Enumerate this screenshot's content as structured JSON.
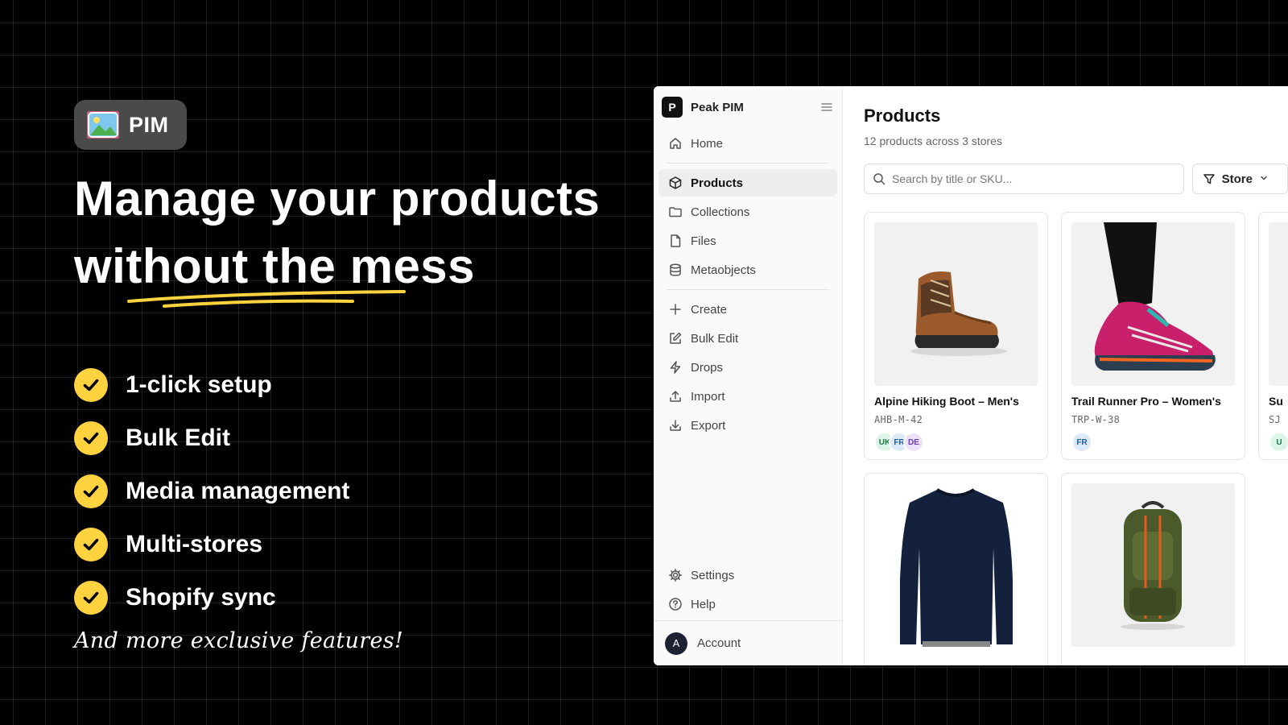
{
  "hero": {
    "badge_label": "PIM",
    "headline_line1": "Manage your products",
    "headline_line2": "without the mess",
    "features": [
      "1-click setup",
      "Bulk Edit",
      "Media management",
      "Multi-stores",
      "Shopify sync"
    ],
    "more": "And more exclusive features!",
    "accent_color": "#ffd23f"
  },
  "app": {
    "brand": {
      "logo_letter": "P",
      "name": "Peak PIM"
    },
    "nav": {
      "home": "Home",
      "products": "Products",
      "collections": "Collections",
      "files": "Files",
      "metaobjects": "Metaobjects",
      "create": "Create",
      "bulk_edit": "Bulk Edit",
      "drops": "Drops",
      "import": "Import",
      "export": "Export",
      "settings": "Settings",
      "help": "Help"
    },
    "account": {
      "initial": "A",
      "label": "Account"
    },
    "main": {
      "title": "Products",
      "subtitle": "12 products across 3 stores",
      "search_placeholder": "Search by title or SKU...",
      "store_filter_label": "Store"
    },
    "products": [
      {
        "name": "Alpine Hiking Boot – Men's",
        "sku": "AHB-M-42",
        "stores": [
          "UK",
          "FR",
          "DE"
        ]
      },
      {
        "name": "Trail Runner Pro – Women's",
        "sku": "TRP-W-38",
        "stores": [
          "FR"
        ]
      },
      {
        "name": "Su",
        "sku": "SJ",
        "stores": [
          "U"
        ]
      },
      {
        "name": "",
        "sku": "",
        "stores": []
      },
      {
        "name": "",
        "sku": "",
        "stores": []
      }
    ]
  }
}
